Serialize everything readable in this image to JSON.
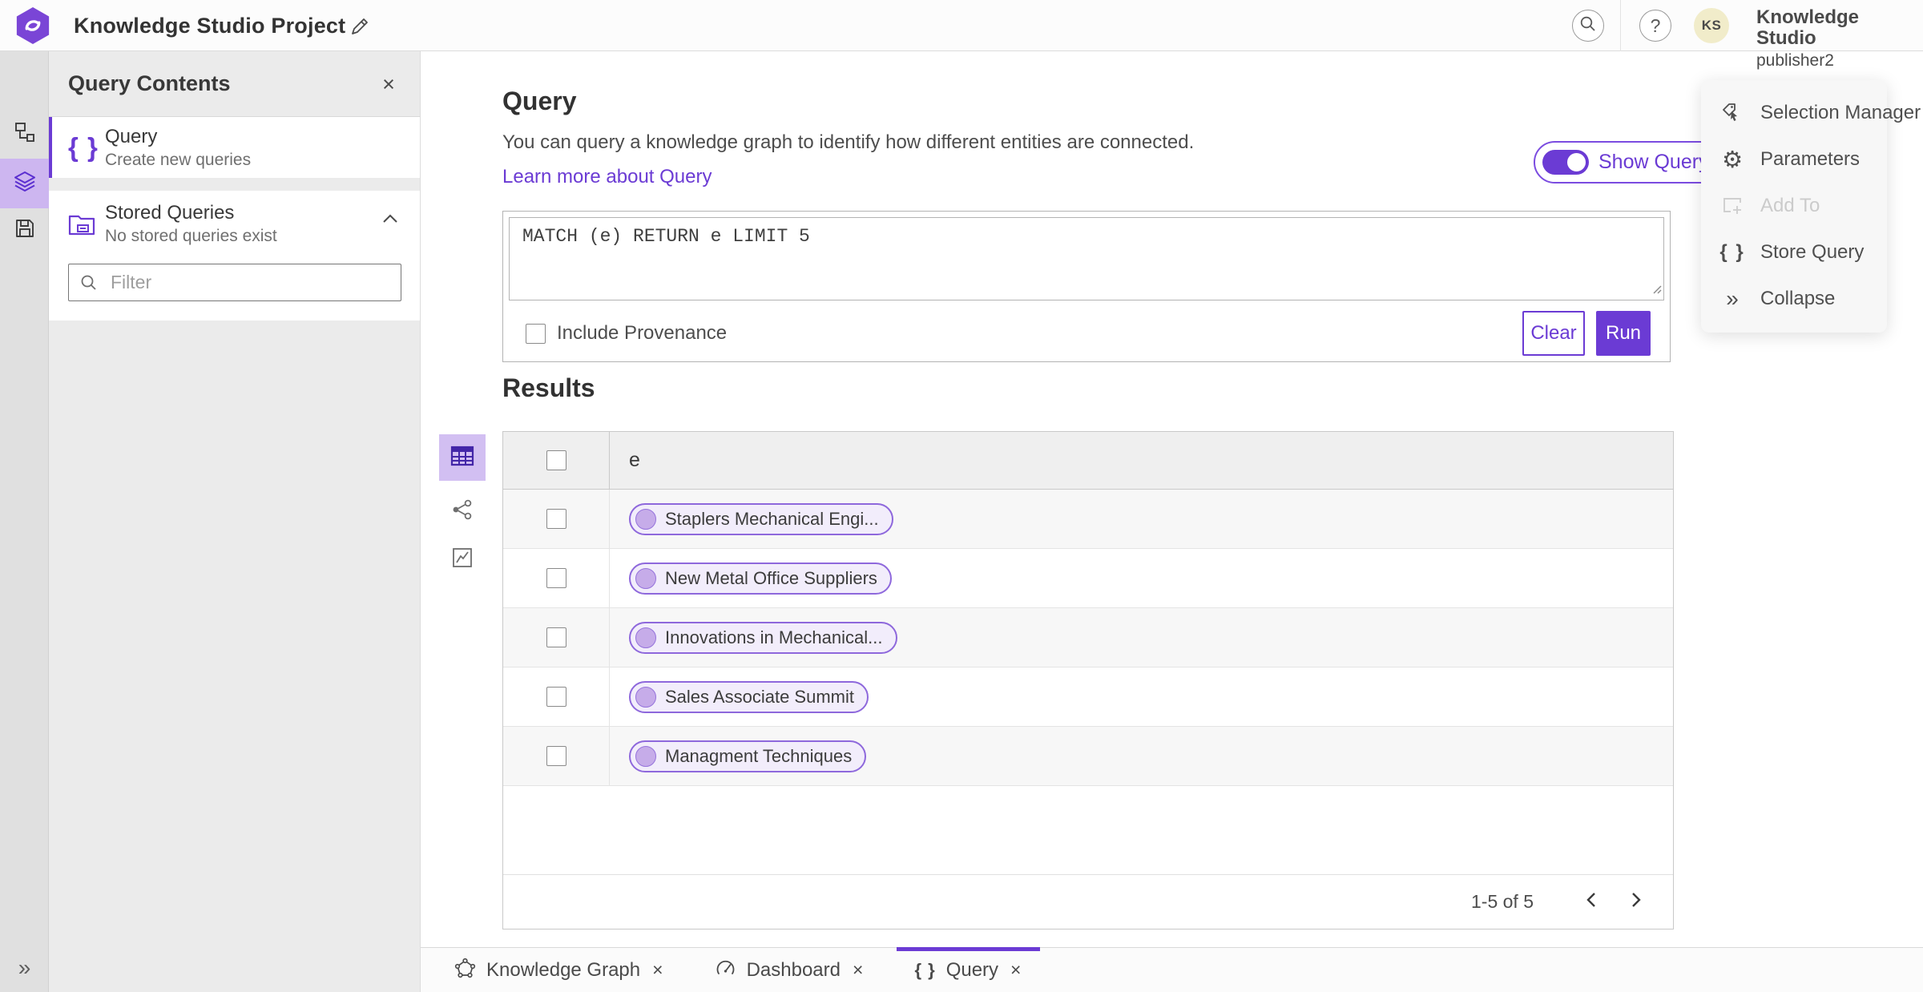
{
  "colors": {
    "primary_purple": "#6b3bd4",
    "selected_tile_purple": "#cdb6f0",
    "pill_background": "#f2edfb",
    "pill_border": "#8e68dc",
    "avatar_background": "#f1ecca"
  },
  "glyphs": {
    "close": "×",
    "question": "?",
    "double_chevron_right": "»",
    "braces": "{ }",
    "avatar_initials_icon": "KS"
  },
  "header": {
    "project_title": "Knowledge Studio Project",
    "app_name": "Knowledge Studio",
    "user_role": "publisher2",
    "avatar_initials": "KS"
  },
  "contents_panel": {
    "title": "Query Contents",
    "query_item": {
      "title": "Query",
      "subtitle": "Create new queries"
    },
    "stored_item": {
      "title": "Stored Queries",
      "subtitle": "No stored queries exist"
    },
    "filter_placeholder": "Filter"
  },
  "query_section": {
    "title": "Query",
    "description": "You can query a knowledge graph to identify how different entities are connected.",
    "link_label": "Learn more about Query",
    "show_query_label": "Show Query",
    "show_query_on": true,
    "query_text": "MATCH (e) RETURN e LIMIT 5",
    "include_provenance_label": "Include Provenance",
    "include_provenance_checked": false,
    "clear_label": "Clear",
    "run_label": "Run"
  },
  "results": {
    "title": "Results",
    "column_header": "e",
    "rows": [
      {
        "label": "Staplers Mechanical Engi..."
      },
      {
        "label": "New Metal Office Suppliers"
      },
      {
        "label": "Innovations in Mechanical..."
      },
      {
        "label": "Sales Associate Summit"
      },
      {
        "label": "Managment Techniques"
      }
    ],
    "pagination_range": "1-5 of 5"
  },
  "right_panel": {
    "items": [
      {
        "label": "Selection Manager",
        "disabled": false
      },
      {
        "label": "Parameters",
        "disabled": false
      },
      {
        "label": "Add To",
        "disabled": true
      },
      {
        "label": "Store Query",
        "disabled": false
      },
      {
        "label": "Collapse",
        "disabled": false
      }
    ]
  },
  "tab_bar": {
    "tabs": [
      {
        "label": "Knowledge Graph",
        "active": false
      },
      {
        "label": "Dashboard",
        "active": false
      },
      {
        "label": "Query",
        "active": true
      }
    ]
  }
}
